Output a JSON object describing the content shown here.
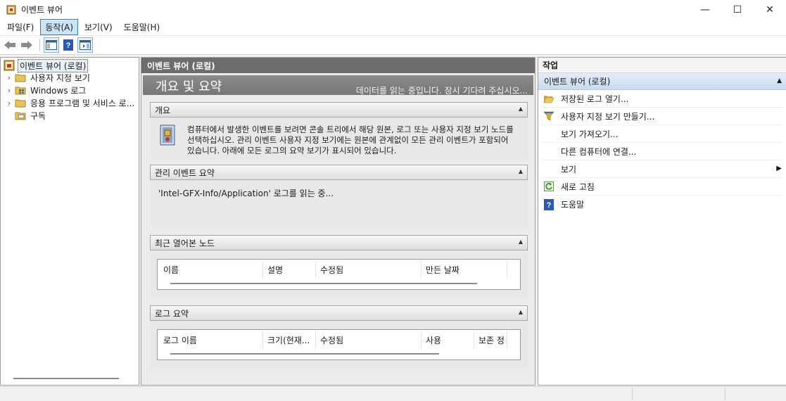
{
  "window": {
    "title": "이벤트 뷰어",
    "min_glyph": "—",
    "max_glyph": "☐",
    "close_glyph": "✕"
  },
  "menu": [
    {
      "label": "파일(F)"
    },
    {
      "label": "동작(A)"
    },
    {
      "label": "보기(V)"
    },
    {
      "label": "도움말(H)"
    }
  ],
  "toolbar": {
    "icons": [
      "back-arrow-icon",
      "forward-arrow-icon",
      "show-hide-tree-icon",
      "help-icon",
      "show-hide-action-icon"
    ]
  },
  "tree": {
    "root": "이벤트 뷰어 (로컬)",
    "items": [
      {
        "label": "사용자 지정 보기"
      },
      {
        "label": "Windows 로그"
      },
      {
        "label": "응용 프로그램 및 서비스 로..."
      },
      {
        "label": "구독"
      }
    ]
  },
  "middle": {
    "header": "이벤트 뷰어 (로컬)",
    "summary_title": "개요 및 요약",
    "summary_status": "데이터를 읽는 중입니다. 잠시 기다려 주십시오...",
    "sections": {
      "overview": {
        "title": "개요",
        "text": "컴퓨터에서 발생한 이벤트를 보려면 콘솔 트리에서 해당 원본, 로그 또는 사용자 지정 보기 노드를 선택하십시오. 관리 이벤트 사용자 지정 보기에는 원본에 관계없이 모든 관리 이벤트가 포함되어 있습니다. 아래에 모든 로그의 요약 보기가 표시되어 있습니다."
      },
      "admin_events": {
        "title": "관리 이벤트 요약",
        "text": "'Intel-GFX-Info/Application' 로그를 읽는 중..."
      },
      "recent_nodes": {
        "title": "최근 열어본 노드",
        "columns": [
          "이름",
          "설명",
          "수정됨",
          "만든 날짜"
        ]
      },
      "log_summary": {
        "title": "로그 요약",
        "columns": [
          "로그 이름",
          "크기(현재...",
          "수정됨",
          "사용",
          "보존 정"
        ]
      }
    }
  },
  "actions": {
    "header": "작업",
    "group": "이벤트 뷰어 (로컬)",
    "items": [
      {
        "label": "저장된 로그 열기...",
        "icon": "open-folder-icon"
      },
      {
        "label": "사용자 지정 보기 만들기...",
        "icon": "filter-funnel-icon"
      },
      {
        "label": "보기 가져오기...",
        "icon": ""
      },
      {
        "label": "다른 컴퓨터에 연결...",
        "icon": ""
      },
      {
        "label": "보기",
        "icon": "",
        "submenu": true
      },
      {
        "label": "새로 고침",
        "icon": "refresh-icon"
      },
      {
        "label": "도움말",
        "icon": "help-icon"
      }
    ]
  },
  "colors": {
    "menu_active_bg": "#cce4f7",
    "mid_header_bg": "#6d6d6d",
    "action_group_bg": "#c9daee"
  }
}
